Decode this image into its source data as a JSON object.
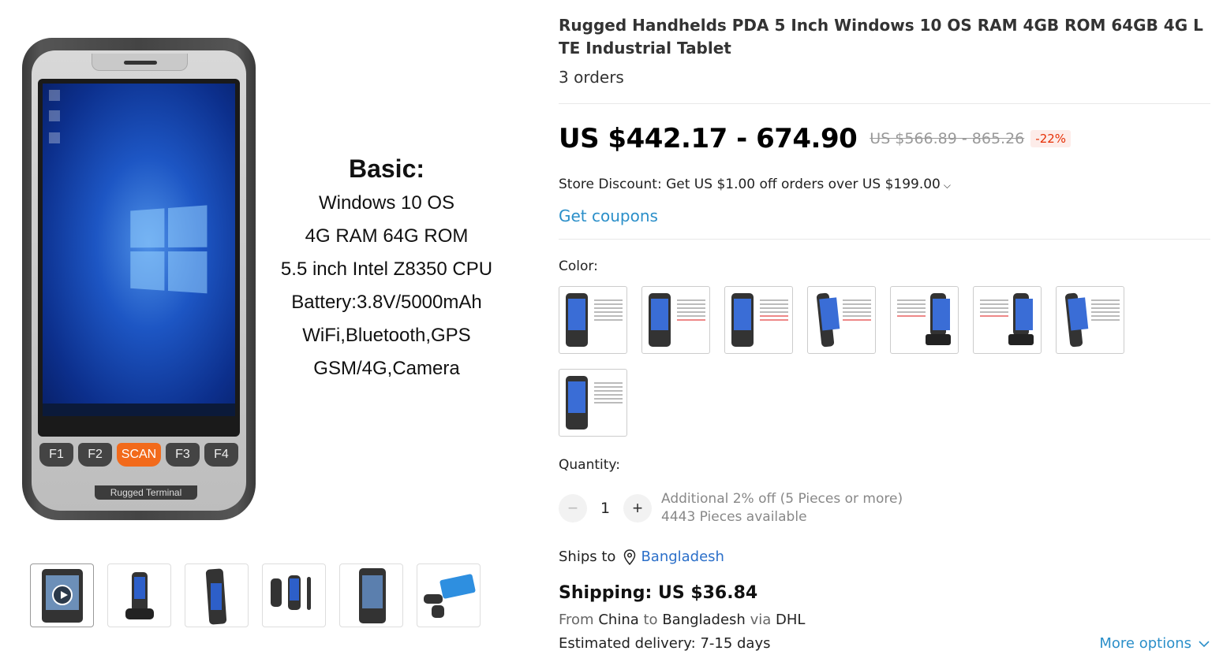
{
  "product": {
    "title": "Rugged Handhelds PDA 5 Inch Windows 10 OS RAM 4GB ROM 64GB 4G LTE Industrial Tablet",
    "orders": "3 orders"
  },
  "main_image": {
    "spec_heading": "Basic:",
    "spec_lines": [
      "Windows 10 OS",
      "4G RAM 64G ROM",
      "5.5 inch Intel Z8350 CPU",
      "Battery:3.8V/5000mAh",
      "WiFi,Bluetooth,GPS",
      "GSM/4G,Camera"
    ],
    "keys": [
      "F1",
      "F2",
      "SCAN",
      "F3",
      "F4"
    ],
    "brand_plate": "Rugged Terminal"
  },
  "thumbnails": [
    {
      "name": "thumb-video",
      "icon": "play-icon"
    },
    {
      "name": "thumb-cradle"
    },
    {
      "name": "thumb-side"
    },
    {
      "name": "thumb-views"
    },
    {
      "name": "thumb-front"
    },
    {
      "name": "thumb-accessories"
    }
  ],
  "price": {
    "current": "US $442.17 - 674.90",
    "original": "US $566.89 - 865.26",
    "discount": "-22%"
  },
  "store_discount": "Store Discount: Get US $1.00 off orders over US $199.00",
  "coupons_label": "Get coupons",
  "color": {
    "label": "Color:",
    "options_count": 8
  },
  "quantity": {
    "label": "Quantity:",
    "value": "1",
    "decrement": "−",
    "increment": "+",
    "note_discount": "Additional 2% off (5 Pieces or more)",
    "note_available": "4443 Pieces available"
  },
  "shipping": {
    "ships_to_label": "Ships to",
    "country": "Bangladesh",
    "cost": "Shipping: US $36.84",
    "from_prefix": "From",
    "origin": "China",
    "to_word": "to",
    "destination": "Bangladesh",
    "via_word": "via",
    "carrier": "DHL",
    "eta_label": "Estimated delivery:",
    "eta_value": "7-15 days",
    "more_options": "More options"
  },
  "colors": {
    "price_red": "#e62e04",
    "link_blue": "#2b8fc9",
    "scan_orange": "#f26a1b"
  }
}
